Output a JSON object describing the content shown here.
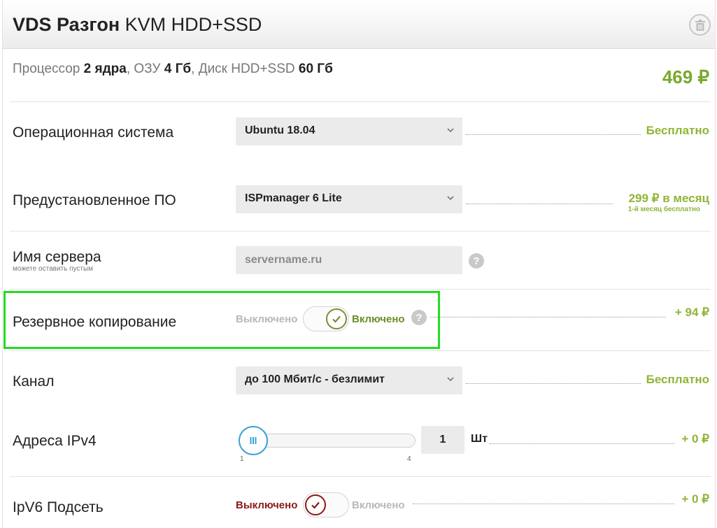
{
  "header": {
    "title_bold": "VDS Разгон",
    "title_rest": " KVM HDD+SSD"
  },
  "specs": {
    "cpu_label": "Процессор ",
    "cpu_value": "2 ядра",
    "ram_label": ", ОЗУ ",
    "ram_value": "4 Гб",
    "disk_label": ", Диск HDD+SSD ",
    "disk_value": "60 Гб",
    "total_price": "469 ₽"
  },
  "os": {
    "label": "Операционная система",
    "selected": "Ubuntu 18.04",
    "price": "Бесплатно"
  },
  "software": {
    "label": "Предустановленное ПО",
    "selected": "ISPmanager 6 Lite",
    "price": "299 ₽ в месяц",
    "price_note": "1-й месяц бесплатно"
  },
  "server_name": {
    "label": "Имя сервера",
    "sublabel": "можете оставить пустым",
    "placeholder": "servername.ru",
    "help": "?"
  },
  "backup": {
    "label": "Резервное копирование",
    "off_label": "Выключено",
    "on_label": "Включено",
    "state": "on",
    "price": "+ 94 ₽",
    "help": "?"
  },
  "channel": {
    "label": "Канал",
    "selected": "до 100 Мбит/с - безлимит",
    "price": "Бесплатно"
  },
  "ipv4": {
    "label": "Адреса IPv4",
    "min": "1",
    "max": "4",
    "value": "1",
    "unit": "Шт",
    "price": "+ 0 ₽"
  },
  "ipv6": {
    "label": "IpV6 Подсеть",
    "off_label": "Выключено",
    "on_label": "Включено",
    "state": "off",
    "price": "+ 0 ₽"
  },
  "colors": {
    "price_green": "#8fb537",
    "total_green": "#7ba82d",
    "toggle_on": "#6b8e23",
    "toggle_off_active": "#8b1a1a",
    "slider_accent": "#3aa0d6",
    "highlight": "#22dd22"
  }
}
